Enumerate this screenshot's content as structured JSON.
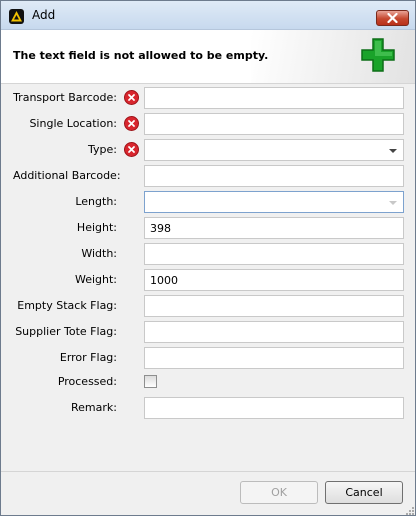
{
  "window": {
    "title": "Add"
  },
  "header": {
    "message": "The text field is not allowed to be empty."
  },
  "form": {
    "transport_barcode": {
      "label": "Transport Barcode:",
      "value": "",
      "error": true
    },
    "single_location": {
      "label": "Single Location:",
      "value": "",
      "error": true
    },
    "type": {
      "label": "Type:",
      "value": "",
      "error": true
    },
    "additional_barcode": {
      "label": "Additional Barcode:",
      "value": ""
    },
    "length": {
      "label": "Length:",
      "value": ""
    },
    "height": {
      "label": "Height:",
      "value": "398"
    },
    "width": {
      "label": "Width:",
      "value": ""
    },
    "weight": {
      "label": "Weight:",
      "value": "1000"
    },
    "empty_stack_flag": {
      "label": "Empty Stack Flag:",
      "value": ""
    },
    "supplier_tote_flag": {
      "label": "Supplier Tote Flag:",
      "value": ""
    },
    "error_flag": {
      "label": "Error Flag:",
      "value": ""
    },
    "processed": {
      "label": "Processed:",
      "checked": false
    },
    "remark": {
      "label": "Remark:",
      "value": ""
    }
  },
  "buttons": {
    "ok": "OK",
    "cancel": "Cancel"
  },
  "icons": {
    "app": "app-logo-icon",
    "close": "close-icon",
    "header": "add-plus-icon",
    "error": "error-icon"
  },
  "colors": {
    "plus_green": "#1aa32a",
    "error_red": "#d8262e",
    "close_red": "#c6482f"
  }
}
